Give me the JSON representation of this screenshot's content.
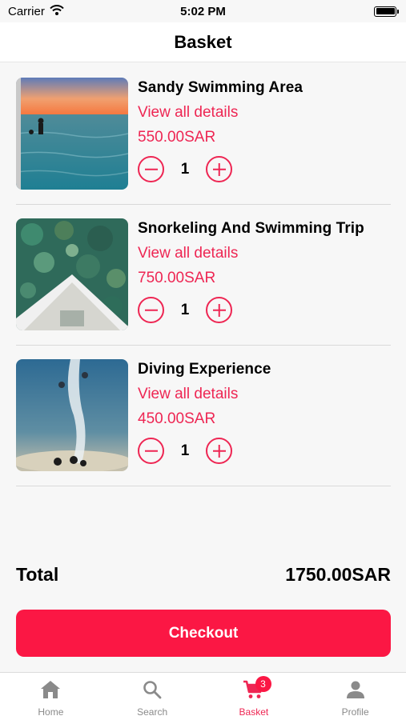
{
  "status_bar": {
    "carrier": "Carrier",
    "time": "5:02 PM"
  },
  "header": {
    "title": "Basket"
  },
  "items": [
    {
      "title": "Sandy Swimming Area",
      "details_link": "View all details",
      "price": "550.00SAR",
      "quantity": "1",
      "image": "sunset-sea-swimmers"
    },
    {
      "title": "Snorkeling And Swimming Trip",
      "details_link": "View all details",
      "price": "750.00SAR",
      "quantity": "1",
      "image": "coral-reef-boat-bow"
    },
    {
      "title": "Diving Experience",
      "details_link": "View all details",
      "price": "450.00SAR",
      "quantity": "1",
      "image": "underwater-divers-bubbles"
    }
  ],
  "summary": {
    "total_label": "Total",
    "total_value": "1750.00SAR"
  },
  "checkout": {
    "label": "Checkout"
  },
  "tabbar": {
    "tabs": [
      {
        "label": "Home",
        "icon": "home-icon"
      },
      {
        "label": "Search",
        "icon": "search-icon"
      },
      {
        "label": "Basket",
        "icon": "cart-icon",
        "badge": "3",
        "active": true
      },
      {
        "label": "Profile",
        "icon": "profile-icon"
      }
    ]
  },
  "colors": {
    "accent": "#ee2653",
    "button": "#fb1744",
    "background": "#f7f7f7"
  }
}
